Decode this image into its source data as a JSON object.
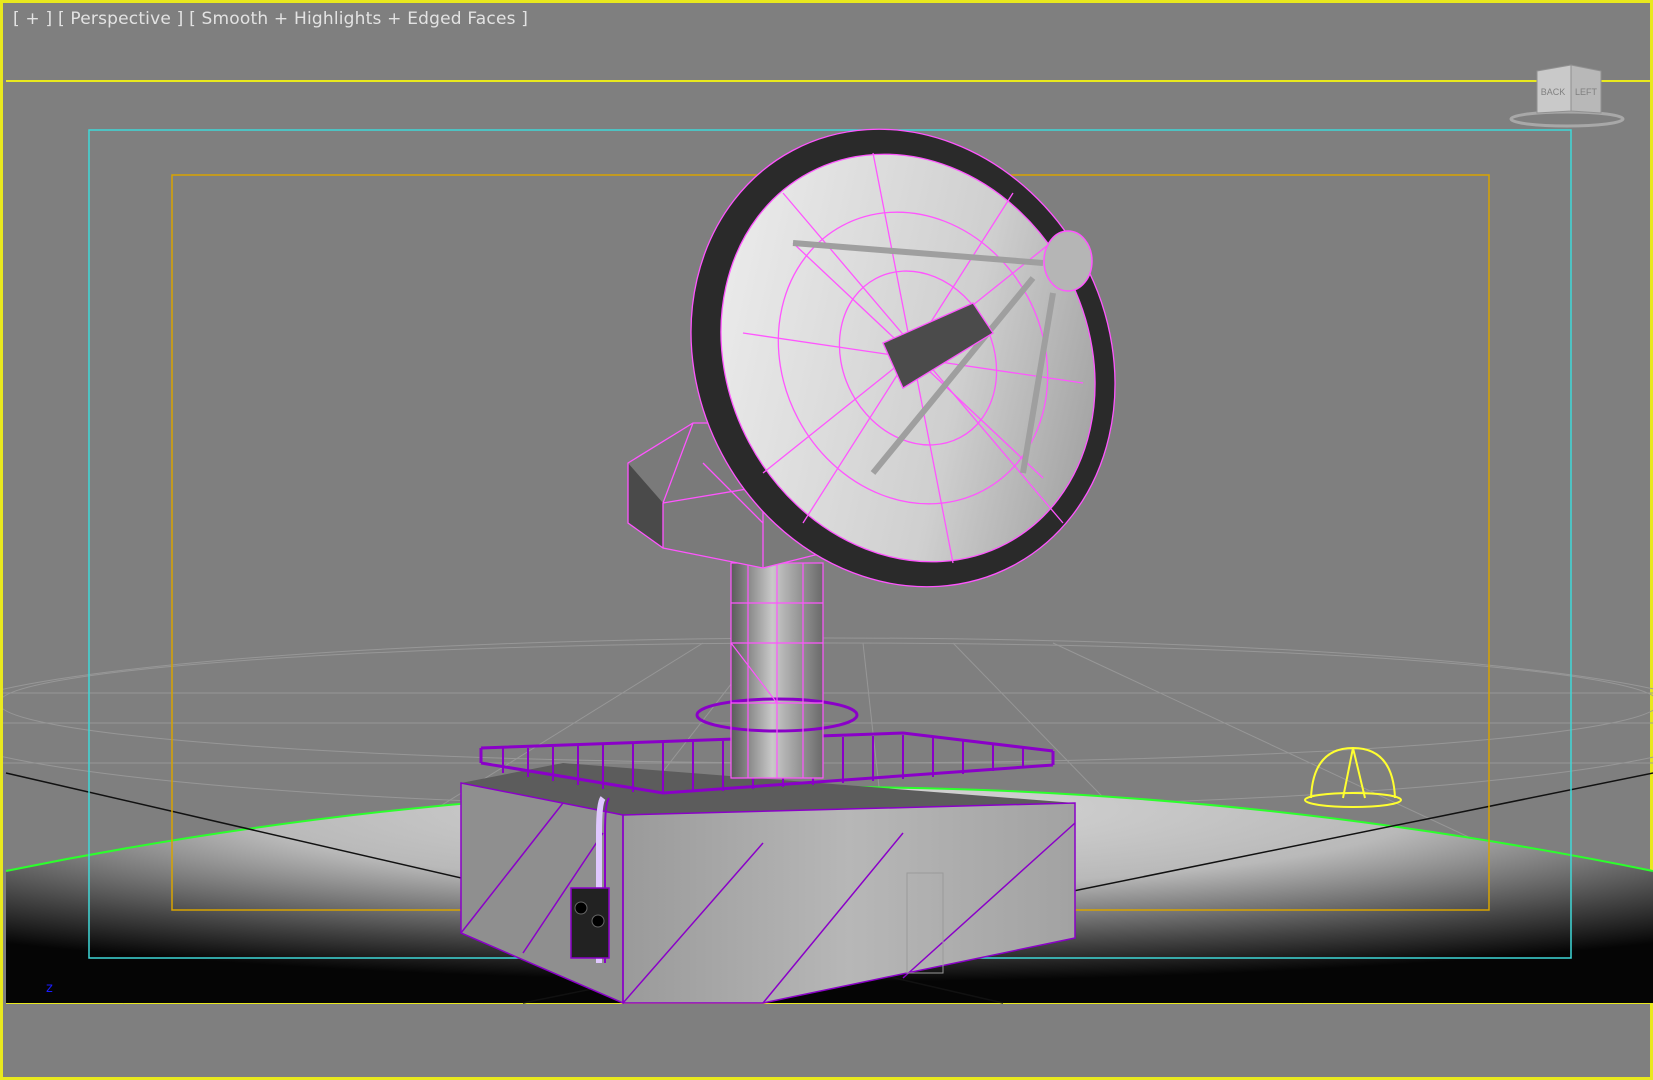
{
  "viewport": {
    "menu_label": "[ + ]",
    "view_label": "[ Perspective ]",
    "shading_label": "[ Smooth + Highlights + Edged Faces ]",
    "viewcube": {
      "back": "BACK",
      "left": "LEFT"
    },
    "axis_label": "z"
  },
  "colors": {
    "viewport_bg": "#7f7f7f",
    "active_border": "#e9e91e",
    "safe_frame_outer": "#3fd8d8",
    "safe_frame_inner": "#d8a400",
    "selection_wire": "#ff55ff",
    "railing": "#8a00c8",
    "ground_rim": "#2cff2c",
    "light_gizmo": "#ffff30"
  },
  "icons": {
    "viewcube": "viewcube-icon",
    "light": "omni-light-icon",
    "axis": "axis-tripod-icon"
  }
}
